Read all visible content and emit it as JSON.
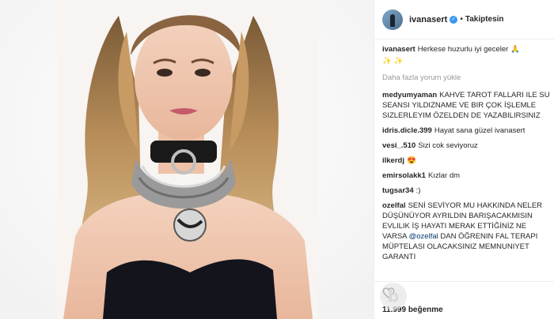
{
  "post": {
    "username": "ivanasert",
    "follow_status": "Takiptesin",
    "caption": {
      "user": "ivanasert",
      "text": "Herkese huzurlu iyi geceler"
    },
    "load_more_label": "Daha fazla yorum yükle",
    "likes": "11.999 beğenme"
  },
  "comments": [
    {
      "user": "medyumyaman",
      "text": "KAHVE TAROT FALLARI ILE SU SEANSI YILDIZNAME VE BIR ÇOK İŞLEMLE SIZLERLEYIM ÖZELDEN DE YAZABILIRSINIZ"
    },
    {
      "user": "idris.dicle.399",
      "text": "Hayat sana güzel ivanasert"
    },
    {
      "user": "vesi_.510",
      "text": "Sizi cok seviyoruz"
    },
    {
      "user": "ilkerdj",
      "text": "😍"
    },
    {
      "user": "emirsolakk1",
      "text": "Kızlar dm"
    },
    {
      "user": "tugsar34",
      "text": ":)"
    },
    {
      "user": "ozelfal",
      "text": "SENİ SEVİYOR MU HAKKINDA NELER DÜŞÜNÜYOR AYRILDIN BARIŞACAKMISIN EVLILIK İŞ HAYATI MERAK ETTİĞİNİZ NE VARSA",
      "mention": "@ozelfal",
      "text2": "DAN ÖĞRENIN FAL TERAPI MÜPTELASI OLACAKSINIZ MEMNUNIYET GARANTI"
    }
  ],
  "icons": {
    "heart": "heart-outline-icon",
    "verified": "verified-badge-icon",
    "watermark": "watermark-b-logo"
  },
  "colors": {
    "accent_blue": "#3897f0",
    "mention": "#003569",
    "muted": "#999999"
  }
}
